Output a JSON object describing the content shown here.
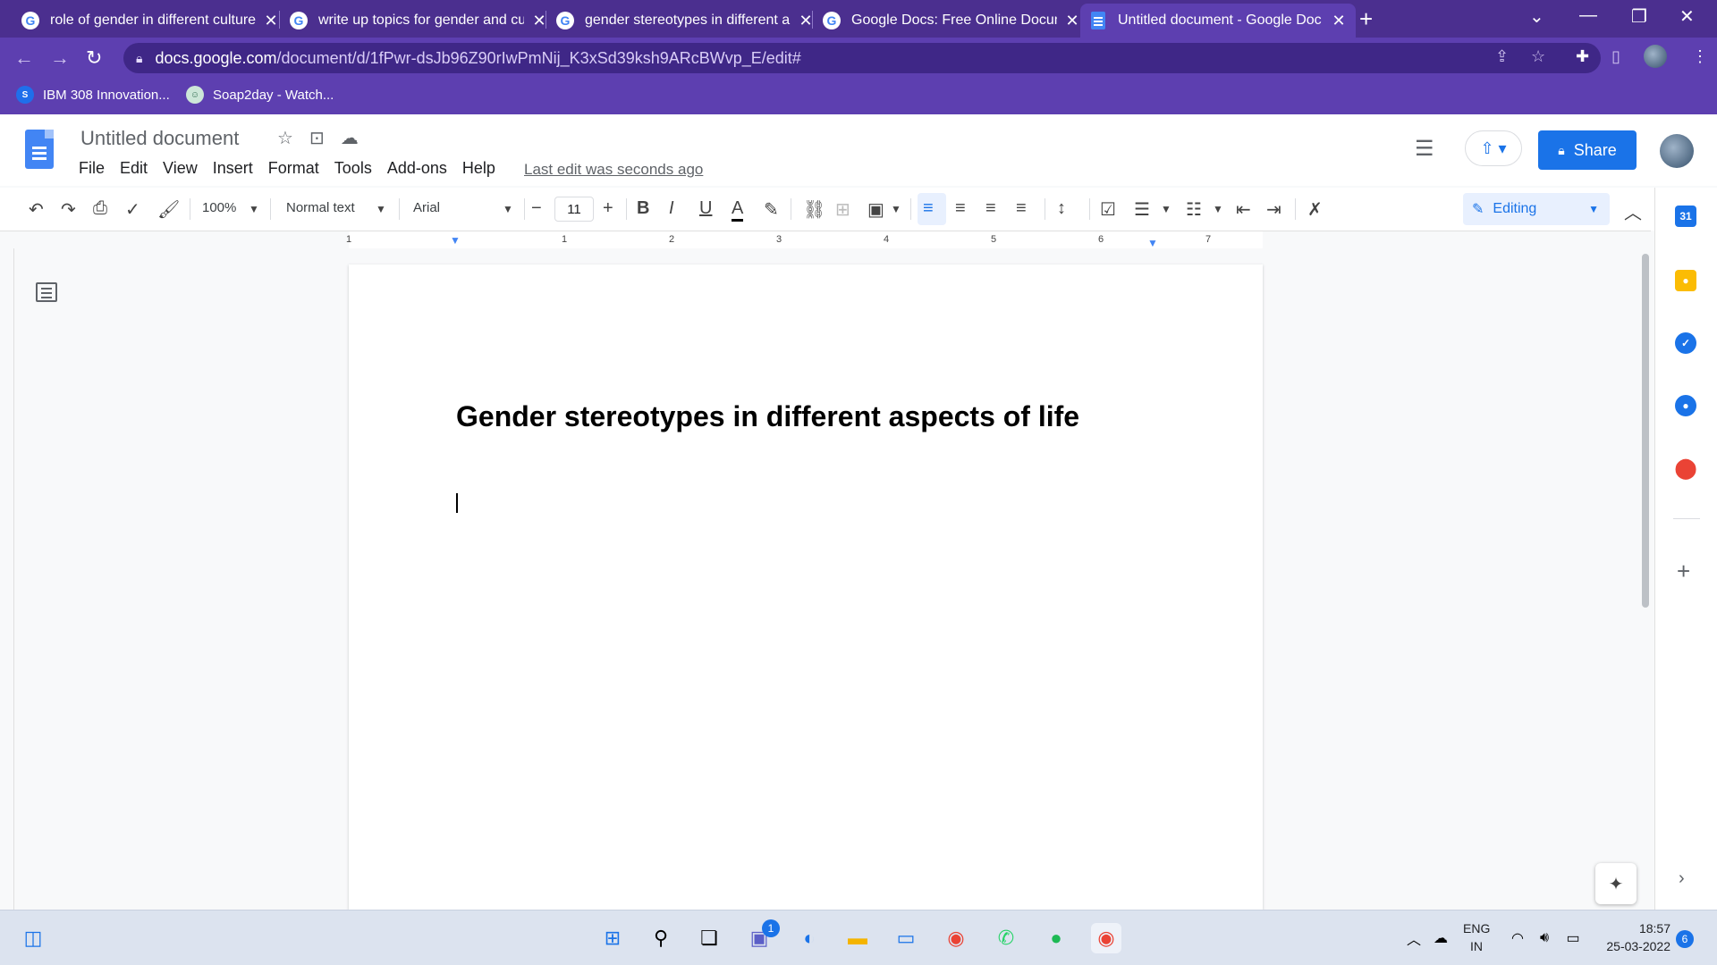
{
  "browser": {
    "tabs": [
      {
        "title": "role of gender in different culture",
        "icon": "google-icon"
      },
      {
        "title": "write up topics for gender and cu",
        "icon": "google-icon"
      },
      {
        "title": "gender stereotypes in different a",
        "icon": "google-icon"
      },
      {
        "title": "Google Docs: Free Online Docum",
        "icon": "google-icon"
      },
      {
        "title": "Untitled document - Google Doc",
        "icon": "docs-icon",
        "active": true
      }
    ],
    "url_host": "docs.google.com",
    "url_path": "/document/d/1fPwr-dsJb96Z90rIwPmNij_K3xSd39ksh9ARcBWvp_E/edit#",
    "bookmarks": [
      {
        "label": "IBM 308 Innovation..."
      },
      {
        "label": "Soap2day - Watch..."
      }
    ]
  },
  "docs": {
    "title": "Untitled document",
    "menu": [
      "File",
      "Edit",
      "View",
      "Insert",
      "Format",
      "Tools",
      "Add-ons",
      "Help"
    ],
    "last_edit": "Last edit was seconds ago",
    "share_label": "Share",
    "toolbar": {
      "zoom": "100%",
      "style": "Normal text",
      "font": "Arial",
      "font_size": "11",
      "mode": "Editing"
    },
    "ruler_numbers": [
      "1",
      "1",
      "2",
      "3",
      "4",
      "5",
      "6",
      "7"
    ]
  },
  "page": {
    "heading": "Gender stereotypes in different aspects of life"
  },
  "taskbar": {
    "lang_top": "ENG",
    "lang_bottom": "IN",
    "time": "18:57",
    "date": "25-03-2022",
    "notif_count": "6",
    "teams_badge": "1"
  },
  "colors": {
    "accent": "#1a73e8",
    "chrome_purple": "#5d3fb0"
  }
}
